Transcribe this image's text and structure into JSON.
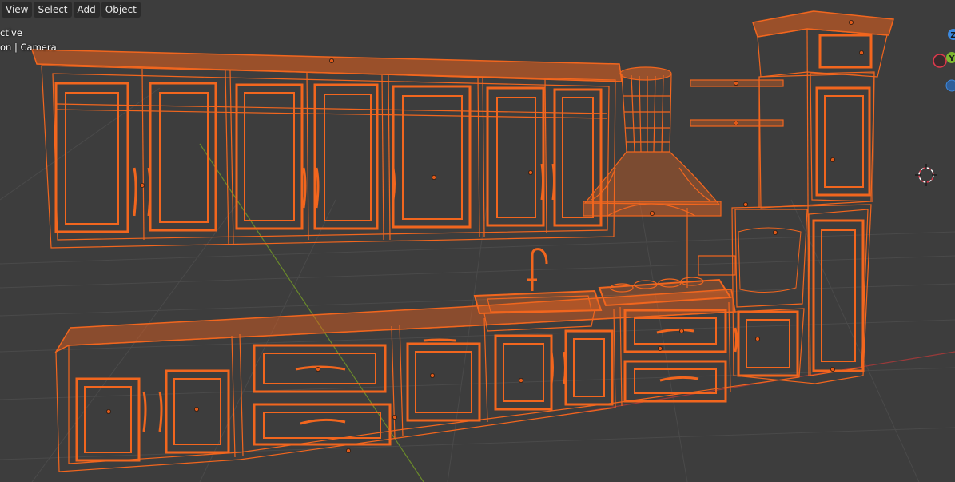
{
  "menubar": {
    "items": [
      {
        "label": "View"
      },
      {
        "label": "Select"
      },
      {
        "label": "Add"
      },
      {
        "label": "Object"
      }
    ]
  },
  "overlay": {
    "line1": "ctive",
    "line2": "on | Camera"
  },
  "gizmo": {
    "axis_z": "Z",
    "axis_y": "Y",
    "colors": {
      "x": "#e0394c",
      "y": "#7cb82f",
      "z": "#3d8ae0"
    }
  },
  "theme": {
    "background": "#3d3d3d",
    "grid": "#4a4a4a",
    "selection_orange": "#f2661e",
    "x_axis_line": "#9a3a3a",
    "y_axis_line": "#6a8a2a"
  },
  "icons": {
    "cursor": "3d-cursor-icon",
    "gizmo": "navigation-gizmo-icon"
  }
}
